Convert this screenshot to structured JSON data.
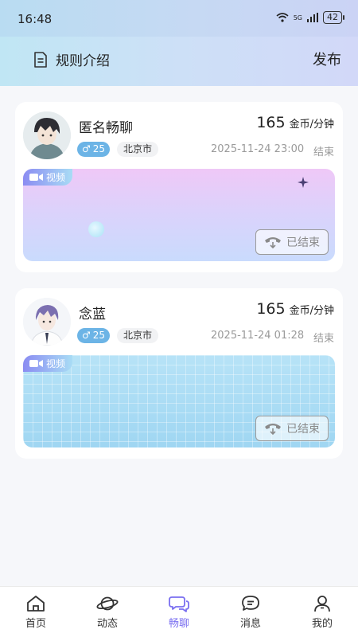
{
  "status_bar": {
    "time": "16:48",
    "network": "5G",
    "battery": "42"
  },
  "header": {
    "rules_label": "规则介绍",
    "publish_label": "发布"
  },
  "cards": [
    {
      "name": "匿名畅聊",
      "price": "165",
      "price_unit": "金币/分钟",
      "gender_symbol": "♂",
      "age": "25",
      "city": "北京市",
      "time": "2025-11-24 23:00",
      "state": "结束",
      "media_tag": "视频",
      "ended_label": "已结束"
    },
    {
      "name": "念蓝",
      "price": "165",
      "price_unit": "金币/分钟",
      "gender_symbol": "♂",
      "age": "25",
      "city": "北京市",
      "time": "2025-11-24 01:28",
      "state": "结束",
      "media_tag": "视频",
      "ended_label": "已结束"
    }
  ],
  "tabbar": {
    "items": [
      {
        "label": "首页",
        "icon": "home-icon"
      },
      {
        "label": "动态",
        "icon": "planet-icon"
      },
      {
        "label": "畅聊",
        "icon": "chat-bubbles-icon"
      },
      {
        "label": "消息",
        "icon": "message-icon"
      },
      {
        "label": "我的",
        "icon": "profile-icon"
      }
    ],
    "active_index": 2
  },
  "colors": {
    "accent": "#7a6ff0",
    "gender_badge": "#6cb4e6"
  }
}
